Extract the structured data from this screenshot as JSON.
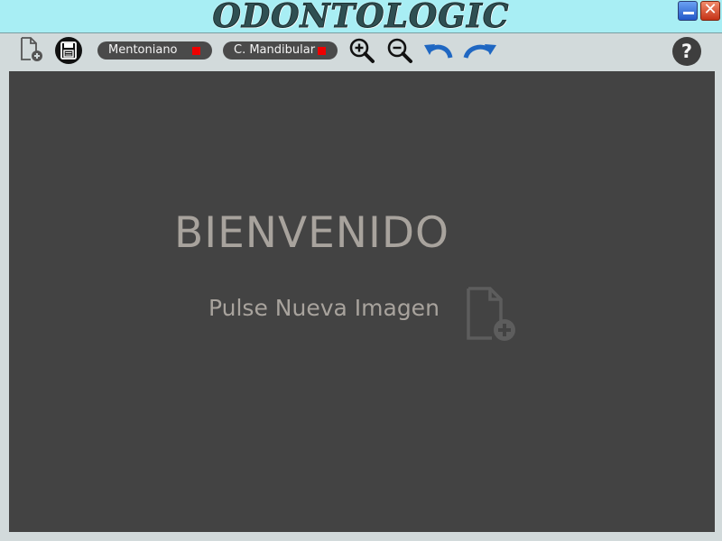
{
  "window": {
    "title": "ODONTOLOGIC",
    "close_symbol": "✕"
  },
  "toolbar": {
    "new_image_icon": "file-plus-icon",
    "save_icon": "floppy-disk-icon",
    "mentoniano_label": "Mentoniano",
    "mandibular_label": "C. Mandibular",
    "indicator_color": "#ee0000",
    "zoom_in_icon": "zoom-in-icon",
    "zoom_out_icon": "zoom-out-icon",
    "undo_icon": "undo-icon",
    "redo_icon": "redo-icon",
    "help_label": "?"
  },
  "main": {
    "welcome": "BIENVENIDO",
    "hint": "Pulse Nueva Imagen",
    "hint_icon": "file-plus-icon",
    "background_color": "#434343",
    "text_color": "#a8a39d"
  },
  "colors": {
    "titlebar": "#a8eef4",
    "toolbar": "#d2dadb",
    "arrow_blue": "#1f67c2"
  }
}
